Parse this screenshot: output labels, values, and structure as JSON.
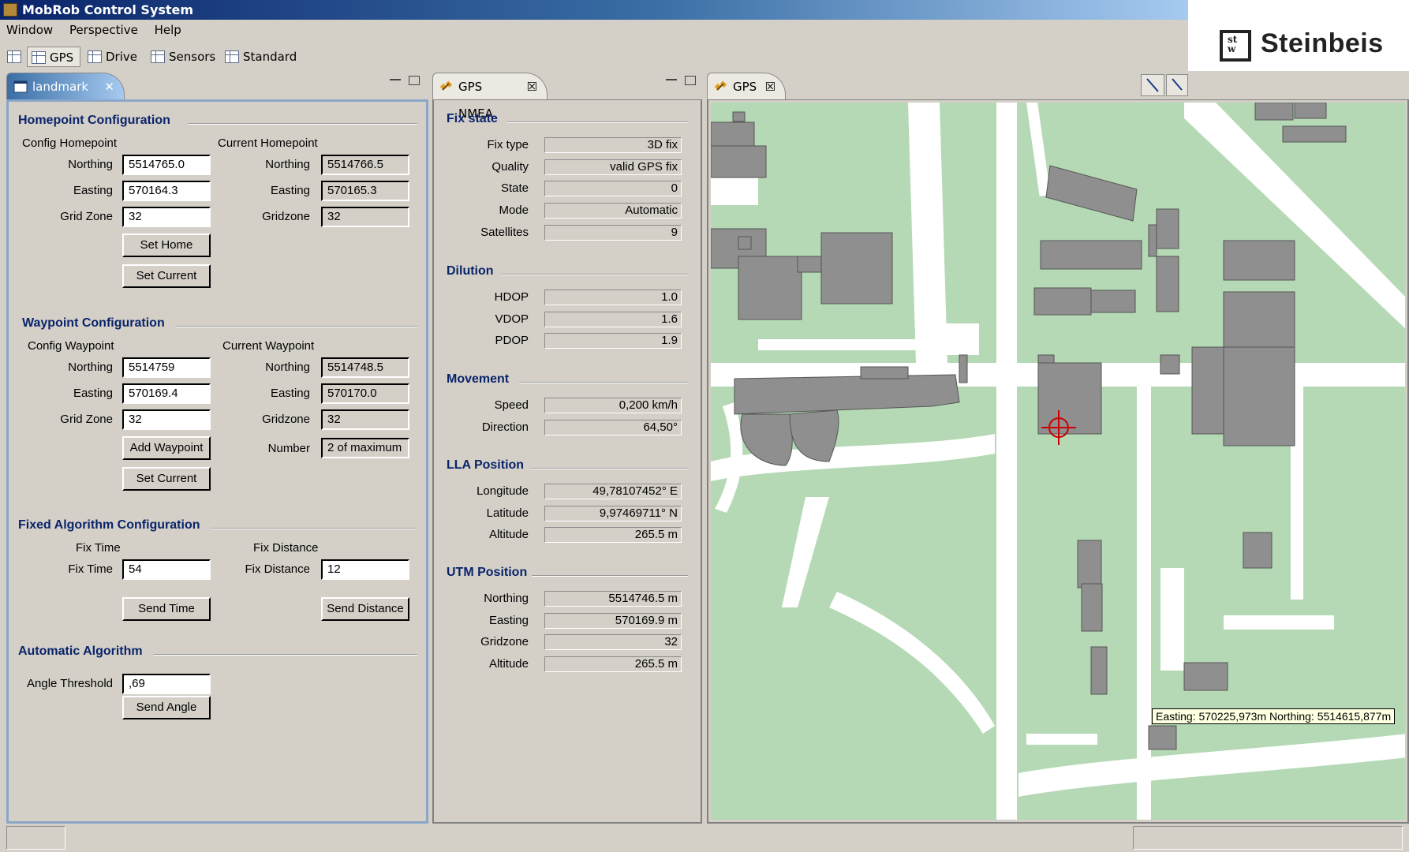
{
  "window": {
    "title": "MobRob Control System",
    "brand": "Steinbeis"
  },
  "menu": [
    "Window",
    "Perspective",
    "Help"
  ],
  "toolbar": {
    "perspectives": [
      "GPS",
      "Drive",
      "Sensors",
      "Standard"
    ],
    "active": "GPS"
  },
  "landmark": {
    "tab_label": "landmark",
    "close_glyph": "✕",
    "homepoint": {
      "title": "Homepoint Configuration",
      "config_label": "Config Homepoint",
      "current_label": "Current Homepoint",
      "northing_label": "Northing",
      "easting_label": "Easting",
      "gridzone_config_label": "Grid Zone",
      "gridzone_current_label": "Gridzone",
      "config_northing": "5514765.0",
      "config_easting": "570164.3",
      "config_gridzone": "32",
      "current_northing": "5514766.5",
      "current_easting": "570165.3",
      "current_gridzone": "32",
      "set_home_label": "Set Home",
      "set_current_label": "Set Current"
    },
    "waypoint": {
      "title": "Waypoint Configuration",
      "config_label": "Config Waypoint",
      "current_label": "Current Waypoint",
      "northing_label": "Northing",
      "easting_label": "Easting",
      "gridzone_config_label": "Grid Zone",
      "gridzone_current_label": "Gridzone",
      "number_label": "Number",
      "config_northing": "5514759",
      "config_easting": "570169.4",
      "config_gridzone": "32",
      "current_northing": "5514748.5",
      "current_easting": "570170.0",
      "current_gridzone": "32",
      "number_value": "2 of maximum",
      "add_waypoint_label": "Add Waypoint",
      "set_current_label": "Set Current"
    },
    "fixed": {
      "title": "Fixed Algorithm Configuration",
      "fix_time_header": "Fix Time",
      "fix_distance_header": "Fix Distance",
      "fix_time_label": "Fix Time",
      "fix_distance_label": "Fix Distance",
      "fix_time_value": "54",
      "fix_distance_value": "12",
      "send_time_label": "Send Time",
      "send_distance_label": "Send Distance"
    },
    "automatic": {
      "title": "Automatic Algorithm",
      "angle_label": "Angle Threshold",
      "angle_value": ",69",
      "send_angle_label": "Send Angle"
    }
  },
  "nmea": {
    "tab_label": "GPS NMEA",
    "close_glyph": "☒",
    "fix_state": {
      "title": "Fix state",
      "rows": [
        {
          "label": "Fix type",
          "value": "3D fix"
        },
        {
          "label": "Quality",
          "value": "valid GPS fix"
        },
        {
          "label": "State",
          "value": "0"
        },
        {
          "label": "Mode",
          "value": "Automatic"
        },
        {
          "label": "Satellites",
          "value": "9"
        }
      ]
    },
    "dilution": {
      "title": "Dilution",
      "rows": [
        {
          "label": "HDOP",
          "value": "1.0"
        },
        {
          "label": "VDOP",
          "value": "1.6"
        },
        {
          "label": "PDOP",
          "value": "1.9"
        }
      ]
    },
    "movement": {
      "title": "Movement",
      "rows": [
        {
          "label": "Speed",
          "value": "0,200 km/h"
        },
        {
          "label": "Direction",
          "value": "64,50°"
        }
      ]
    },
    "lla": {
      "title": "LLA Position",
      "rows": [
        {
          "label": "Longitude",
          "value": "49,78107452° E"
        },
        {
          "label": "Latitude",
          "value": "9,97469711° N"
        },
        {
          "label": "Altitude",
          "value": "265.5 m"
        }
      ]
    },
    "utm": {
      "title": "UTM Position",
      "rows": [
        {
          "label": "Northing",
          "value": "5514746.5 m"
        },
        {
          "label": "Easting",
          "value": "570169.9 m"
        },
        {
          "label": "Gridzone",
          "value": "32"
        },
        {
          "label": "Altitude",
          "value": "265.5 m"
        }
      ]
    }
  },
  "gps_map": {
    "tab_label": "GPS",
    "close_glyph": "☒",
    "tooltip": "Easting: 570225,973m Northing: 5514615,877m",
    "colors": {
      "grass": "#b5d9b5",
      "building": "#8f8f8f",
      "road": "#ffffff",
      "marker": "#cc0000"
    }
  }
}
